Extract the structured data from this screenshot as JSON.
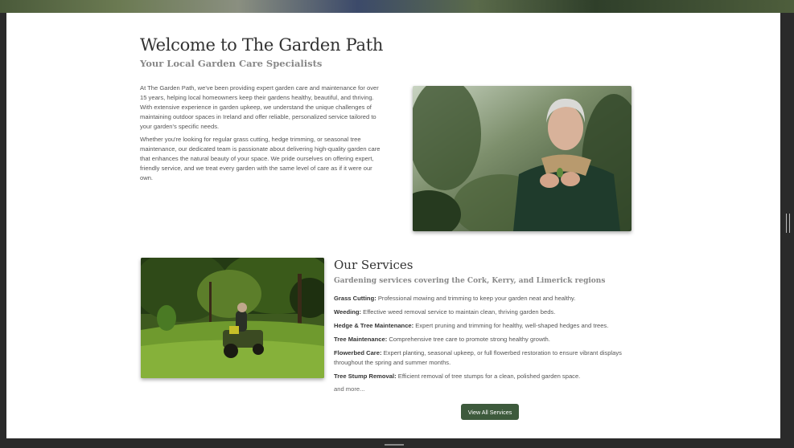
{
  "welcome": {
    "title": "Welcome to The Garden Path",
    "subtitle": "Your Local Garden Care Specialists",
    "paragraphs": [
      "At The Garden Path, we've been providing expert garden care and maintenance for over 15 years, helping local homeowners keep their gardens healthy, beautiful, and thriving. With extensive experience in garden upkeep, we understand the unique challenges of maintaining outdoor spaces in Ireland and offer reliable, personalized service tailored to your garden's specific needs.",
      "Whether you're looking for regular grass cutting, hedge trimming, or seasonal tree maintenance, our dedicated team is passionate about delivering high-quality garden care that enhances the natural beauty of your space. We pride ourselves on offering expert, friendly service, and we treat every garden with the same level of care as if it were our own."
    ]
  },
  "services": {
    "title": "Our Services",
    "subtitle": "Gardening services covering the Cork, Kerry, and Limerick regions",
    "items": [
      {
        "name": "Grass Cutting:",
        "desc": " Professional mowing and trimming to keep your garden neat and healthy."
      },
      {
        "name": "Weeding:",
        "desc": " Effective weed removal service to maintain clean, thriving garden beds."
      },
      {
        "name": "Hedge & Tree Maintenance:",
        "desc": " Expert pruning and trimming for healthy, well-shaped hedges and trees."
      },
      {
        "name": "Tree Maintenance:",
        "desc": " Comprehensive tree care to promote strong healthy growth."
      },
      {
        "name": "Flowerbed Care:",
        "desc": " Expert planting, seasonal upkeep, or full flowerbed restoration to ensure vibrant displays throughout the spring and summer months."
      },
      {
        "name": "Tree Stump Removal:",
        "desc": " Efficient removal of tree stumps for a clean, polished garden space."
      }
    ],
    "more": "and more...",
    "button_label": "View All Services"
  },
  "colors": {
    "button": "#3d5a3c",
    "heading": "#333333",
    "subheading": "#888888"
  }
}
